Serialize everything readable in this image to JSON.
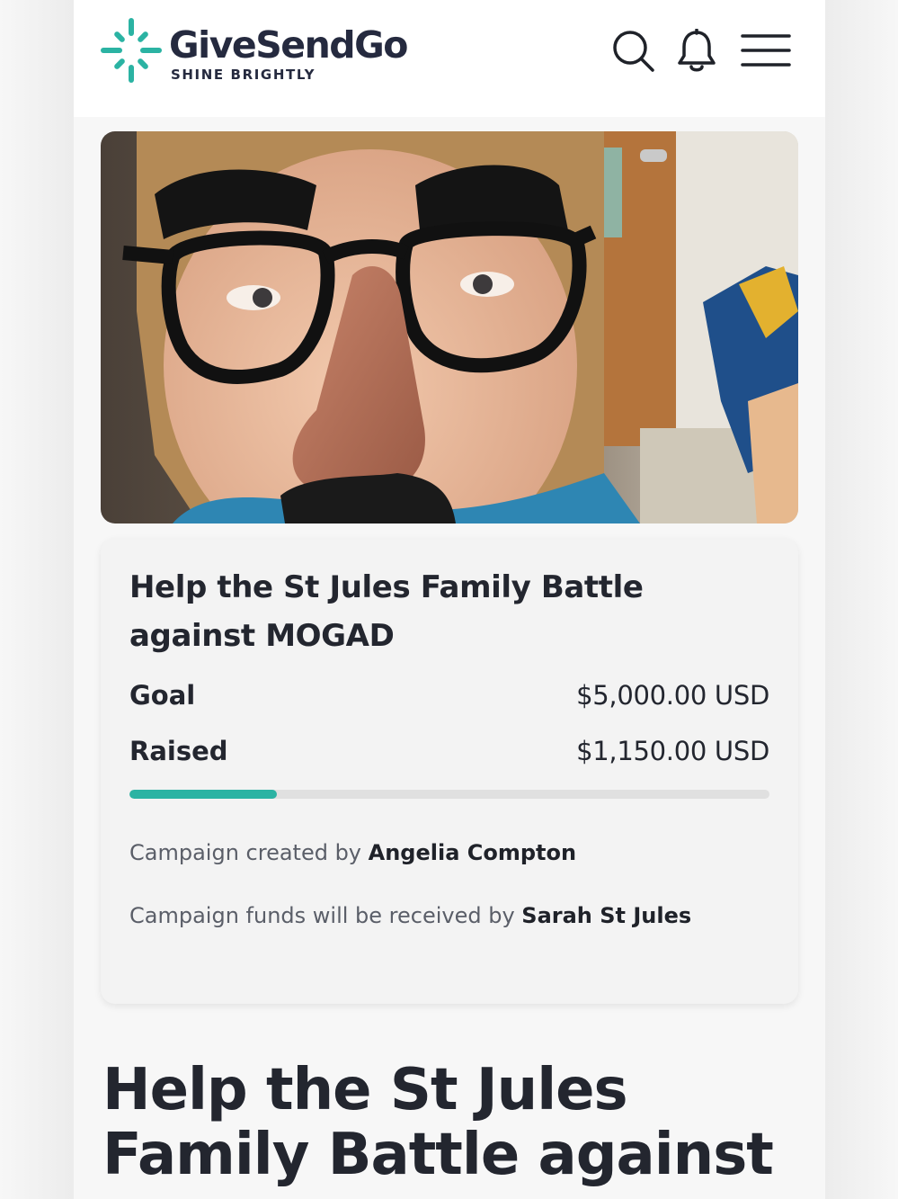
{
  "header": {
    "brand_name": "GiveSendGo",
    "brand_tagline": "SHINE BRIGHTLY",
    "icons": [
      "search-icon",
      "bell-icon",
      "menu-icon"
    ],
    "brand_color": "#2bb3a3",
    "brand_text_color": "#252a3f"
  },
  "hero": {
    "image": "campaign-photo"
  },
  "campaign": {
    "title": "Help the St Jules Family Battle against MOGAD",
    "goal_label": "Goal",
    "goal_value": "$5,000.00 USD",
    "raised_label": "Raised",
    "raised_value": "$1,150.00 USD",
    "progress_percent": 23,
    "created_by_prefix": "Campaign created by",
    "created_by_name": "Angelia Compton",
    "recipient_prefix": "Campaign funds will be received by",
    "recipient_name": "Sarah St Jules",
    "progress_color": "#2bb3a3"
  },
  "main": {
    "heading": "Help the St Jules Family Battle against"
  }
}
